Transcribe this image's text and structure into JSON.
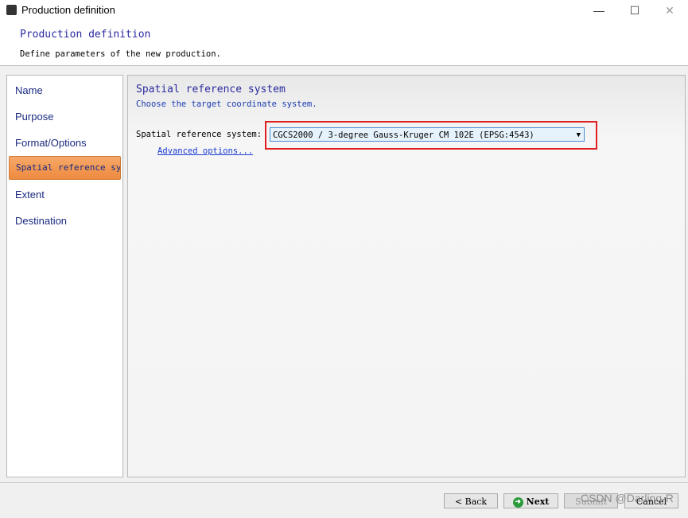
{
  "window": {
    "title": "Production definition",
    "minimize": "—",
    "maximize": "☐",
    "close": "✕"
  },
  "header": {
    "title": "Production definition",
    "subtitle": "Define parameters of the new production."
  },
  "nav": {
    "items": [
      "Name",
      "Purpose",
      "Format/Options",
      "Spatial reference system",
      "Extent",
      "Destination"
    ],
    "selected": "Spatial reference system",
    "selected_color": "#ef8a40"
  },
  "panel": {
    "title": "Spatial reference system",
    "subtitle": "Choose the target coordinate system.",
    "field_label": "Spatial reference system:",
    "field_value": "CGCS2000 / 3-degree Gauss-Kruger CM 102E (EPSG:4543)",
    "advanced_link": "Advanced options..."
  },
  "footer": {
    "back": "< Back",
    "next": "Next",
    "submit": "Submit",
    "cancel": "Cancel"
  },
  "watermark": "CSDN @Darling-R"
}
